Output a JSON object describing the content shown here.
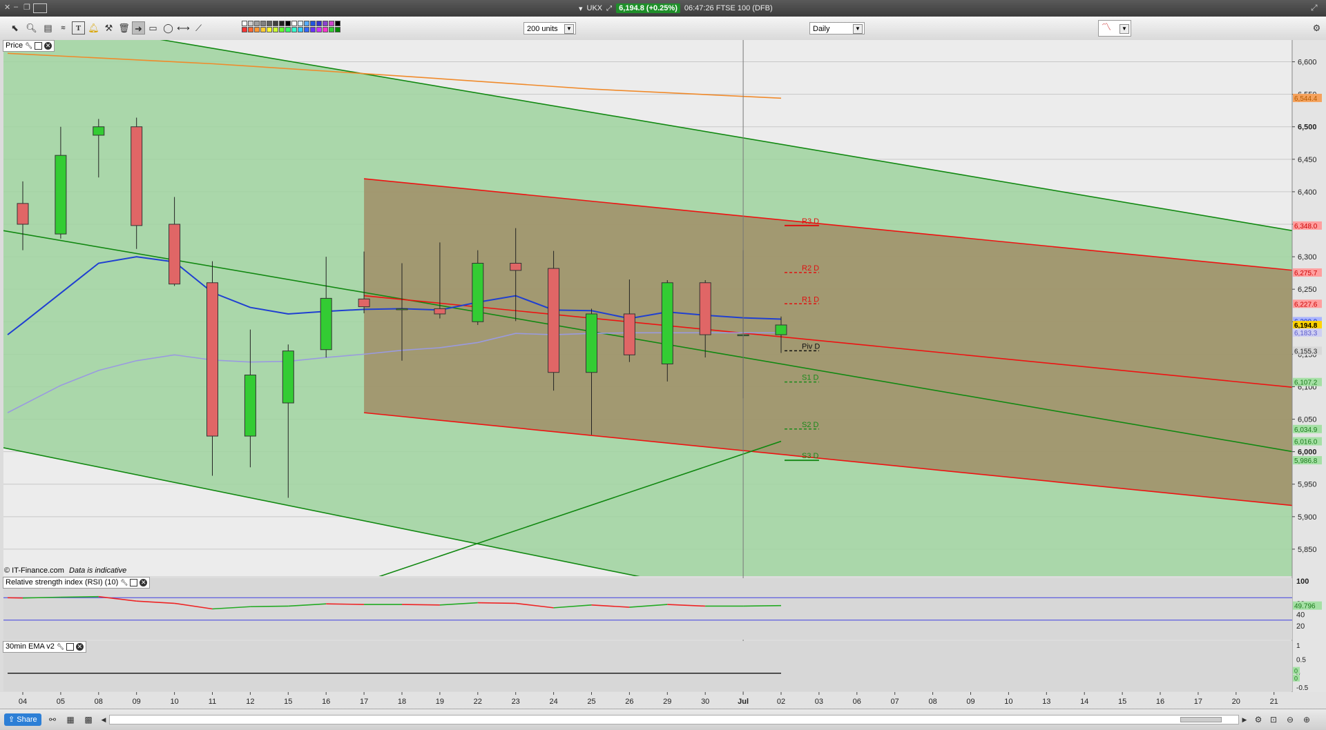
{
  "titlebar": {
    "symbol": "UKX",
    "quote": "6,194.8 (+0.25%)",
    "info": "06:47:26 FTSE 100 (DFB)"
  },
  "toolbar": {
    "units": "200 units",
    "interval": "Daily"
  },
  "panels": {
    "price_label": "Price",
    "rsi_label": "Relative strength index (RSI) (10)",
    "ema_label": "30min EMA v2",
    "copyright": "© IT-Finance.com",
    "disclaimer": "Data is indicative"
  },
  "statusbar": {
    "share": "Share"
  },
  "colors": {
    "up": "#33cc33",
    "down": "#e06666",
    "channel_green": "#9fd39f",
    "channel_brown": "#a08a63",
    "ma_blue": "#1f3fd1",
    "ma_lavender": "#9a9ae0",
    "ma_orange": "#f08a2a",
    "last_price": "#ffd400"
  },
  "chart_data": [
    {
      "type": "candlestick",
      "title": "Price",
      "ylim": [
        5800,
        6625
      ],
      "y_ticks": [
        "6,600",
        "6,550",
        "6,500",
        "6,450",
        "6,400",
        "6,350",
        "6,300",
        "6,250",
        "6,200",
        "6,150",
        "6,100",
        "6,050",
        "6,000",
        "5,950",
        "5,900",
        "5,850"
      ],
      "x_labels": [
        "04",
        "05",
        "08",
        "09",
        "10",
        "11",
        "12",
        "15",
        "16",
        "17",
        "18",
        "19",
        "22",
        "23",
        "24",
        "25",
        "26",
        "29",
        "30",
        "Jul",
        "02",
        "03",
        "06",
        "07",
        "08",
        "09",
        "10",
        "13",
        "14",
        "15",
        "16",
        "17",
        "20",
        "21"
      ],
      "candles": [
        {
          "x": "04",
          "open": 6382,
          "high": 6416,
          "low": 6310,
          "close": 6350
        },
        {
          "x": "05",
          "open": 6335,
          "high": 6500,
          "low": 6328,
          "close": 6456
        },
        {
          "x": "08",
          "open": 6487,
          "high": 6512,
          "low": 6422,
          "close": 6500
        },
        {
          "x": "09",
          "open": 6500,
          "high": 6514,
          "low": 6312,
          "close": 6348
        },
        {
          "x": "10",
          "open": 6350,
          "high": 6392,
          "low": 6255,
          "close": 6258
        },
        {
          "x": "11",
          "open": 6260,
          "high": 6293,
          "low": 5963,
          "close": 6024
        },
        {
          "x": "12",
          "open": 6024,
          "high": 6188,
          "low": 5976,
          "close": 6118
        },
        {
          "x": "15",
          "open": 6075,
          "high": 6165,
          "low": 5929,
          "close": 6155
        },
        {
          "x": "16",
          "open": 6157,
          "high": 6300,
          "low": 6145,
          "close": 6236
        },
        {
          "x": "17",
          "open": 6235,
          "high": 6308,
          "low": 6213,
          "close": 6223
        },
        {
          "x": "18",
          "open": 6220,
          "high": 6290,
          "low": 6140,
          "close": 6220
        },
        {
          "x": "19",
          "open": 6220,
          "high": 6322,
          "low": 6205,
          "close": 6212
        },
        {
          "x": "22",
          "open": 6200,
          "high": 6310,
          "low": 6195,
          "close": 6290
        },
        {
          "x": "23",
          "open": 6290,
          "high": 6344,
          "low": 6201,
          "close": 6279
        },
        {
          "x": "24",
          "open": 6282,
          "high": 6309,
          "low": 6094,
          "close": 6122
        },
        {
          "x": "25",
          "open": 6122,
          "high": 6220,
          "low": 6026,
          "close": 6212
        },
        {
          "x": "26",
          "open": 6212,
          "high": 6265,
          "low": 6138,
          "close": 6149
        },
        {
          "x": "29",
          "open": 6135,
          "high": 6264,
          "low": 6108,
          "close": 6260
        },
        {
          "x": "30",
          "open": 6260,
          "high": 6264,
          "low": 6145,
          "close": 6180
        },
        {
          "x": "Jul",
          "open": 6180,
          "high": 6310,
          "low": 6082,
          "close": 6180
        },
        {
          "x": "02",
          "open": 6180,
          "high": 6208,
          "low": 6152,
          "close": 6195
        }
      ],
      "channels": [
        {
          "name": "outer",
          "top": [
            {
              "x": "04",
              "y": 6670
            },
            {
              "x": "21",
              "y": 6345
            }
          ],
          "bottom": [
            {
              "x": "04",
              "y": 6000
            },
            {
              "x": "21",
              "y": 5610
            }
          ]
        },
        {
          "name": "inner",
          "top": [
            {
              "x": "17",
              "y": 6420
            },
            {
              "x": "21",
              "y": 6282
            }
          ],
          "bottom": [
            {
              "x": "17",
              "y": 6060
            },
            {
              "x": "21",
              "y": 5920
            }
          ]
        }
      ],
      "lines": [
        {
          "name": "mid-channel",
          "color": "green",
          "points": [
            {
              "x": "04",
              "y": 6335
            },
            {
              "x": "21",
              "y": 6005
            }
          ]
        },
        {
          "name": "inner-mid",
          "color": "red",
          "points": [
            {
              "x": "17",
              "y": 6240
            },
            {
              "x": "21",
              "y": 6102
            }
          ]
        },
        {
          "name": "rising-trend",
          "color": "green",
          "points": [
            {
              "x": "17",
              "y": 5800
            },
            {
              "x": "02",
              "y": 6016
            }
          ]
        }
      ],
      "moving_averages": [
        {
          "color": "blue",
          "values": [
            [
              -0.4,
              6180
            ],
            [
              0,
              6198
            ],
            [
              2,
              6290
            ],
            [
              3,
              6300
            ],
            [
              4,
              6292
            ],
            [
              5,
              6245
            ],
            [
              6,
              6222
            ],
            [
              7,
              6212
            ],
            [
              8,
              6216
            ],
            [
              9,
              6219
            ],
            [
              10,
              6220
            ],
            [
              11,
              6218
            ],
            [
              12,
              6230
            ],
            [
              13,
              6240
            ],
            [
              14,
              6218
            ],
            [
              15,
              6217
            ],
            [
              16,
              6205
            ],
            [
              17,
              6215
            ],
            [
              18,
              6210
            ],
            [
              19,
              6206
            ],
            [
              20,
              6204
            ]
          ]
        },
        {
          "color": "lavender",
          "values": [
            [
              -0.4,
              6060
            ],
            [
              1,
              6102
            ],
            [
              2,
              6125
            ],
            [
              3,
              6140
            ],
            [
              4,
              6149
            ],
            [
              5,
              6141
            ],
            [
              6,
              6138
            ],
            [
              7,
              6139
            ],
            [
              8,
              6145
            ],
            [
              9,
              6150
            ],
            [
              10,
              6156
            ],
            [
              11,
              6160
            ],
            [
              12,
              6168
            ],
            [
              13,
              6182
            ],
            [
              14,
              6180
            ],
            [
              15,
              6182
            ],
            [
              16,
              6183
            ],
            [
              17,
              6183
            ],
            [
              18,
              6183
            ],
            [
              19,
              6183
            ],
            [
              20,
              6183
            ]
          ]
        },
        {
          "color": "orange",
          "values": [
            [
              -0.4,
              6613
            ],
            [
              5,
              6597
            ],
            [
              10,
              6578
            ],
            [
              15,
              6558
            ],
            [
              20,
              6544
            ]
          ]
        }
      ],
      "pivots": [
        {
          "label": "R3 D",
          "value": 6348.0,
          "color": "red"
        },
        {
          "label": "R2 D",
          "value": 6275.7,
          "color": "red"
        },
        {
          "label": "R1 D",
          "value": 6227.6,
          "color": "red"
        },
        {
          "label": "Piv D",
          "value": 6155.3,
          "color": "black"
        },
        {
          "label": "S1 D",
          "value": 6107.2,
          "color": "green"
        },
        {
          "label": "S2 D",
          "value": 6034.9,
          "color": "green"
        },
        {
          "label": "S3 D",
          "value": 5986.8,
          "color": "green"
        }
      ],
      "price_tags": [
        {
          "text": "6,544.4",
          "value": 6544.4,
          "color": "orange"
        },
        {
          "text": "6,348.0",
          "value": 6348.0,
          "color": "red"
        },
        {
          "text": "6,275.7",
          "value": 6275.7,
          "color": "red"
        },
        {
          "text": "6,227.6",
          "value": 6227.6,
          "color": "red"
        },
        {
          "text": "6,200.9",
          "value": 6200.9,
          "color": "blue"
        },
        {
          "text": "6,194.8",
          "value": 6194.8,
          "color": "yellow"
        },
        {
          "text": "6,183.3",
          "value": 6183.3,
          "color": "lavender"
        },
        {
          "text": "6,155.3",
          "value": 6155.3,
          "color": "gray"
        },
        {
          "text": "6,107.2",
          "value": 6107.2,
          "color": "green"
        },
        {
          "text": "6,034.9",
          "value": 6034.9,
          "color": "green"
        },
        {
          "text": "6,016.0",
          "value": 6016.0,
          "color": "green"
        },
        {
          "text": "5,986.8",
          "value": 5986.8,
          "color": "green"
        }
      ]
    },
    {
      "type": "line",
      "title": "Relative strength index (RSI) (10)",
      "ylim": [
        0,
        100
      ],
      "y_ticks": [
        "100",
        "60",
        "40",
        "20"
      ],
      "bands": [
        70,
        30
      ],
      "values": [
        [
          -0.4,
          70
        ],
        [
          0,
          69.5
        ],
        [
          1,
          71
        ],
        [
          2,
          72
        ],
        [
          3,
          64
        ],
        [
          4,
          60
        ],
        [
          5,
          50
        ],
        [
          6,
          54
        ],
        [
          7,
          55
        ],
        [
          8,
          59
        ],
        [
          9,
          58
        ],
        [
          10,
          58
        ],
        [
          11,
          57
        ],
        [
          12,
          61
        ],
        [
          13,
          60
        ],
        [
          14,
          52
        ],
        [
          15,
          57
        ],
        [
          16,
          53
        ],
        [
          17,
          58
        ],
        [
          18,
          55
        ],
        [
          19,
          55
        ],
        [
          20,
          56
        ]
      ],
      "last_value": "49.796"
    },
    {
      "type": "line",
      "title": "30min EMA v2",
      "ylim": [
        -0.5,
        1
      ],
      "y_ticks": [
        "1",
        "0.5",
        "0",
        "-0.5"
      ],
      "values": [
        [
          -0.4,
          0
        ],
        [
          20,
          0
        ]
      ],
      "tags": [
        "0",
        "0"
      ]
    }
  ]
}
